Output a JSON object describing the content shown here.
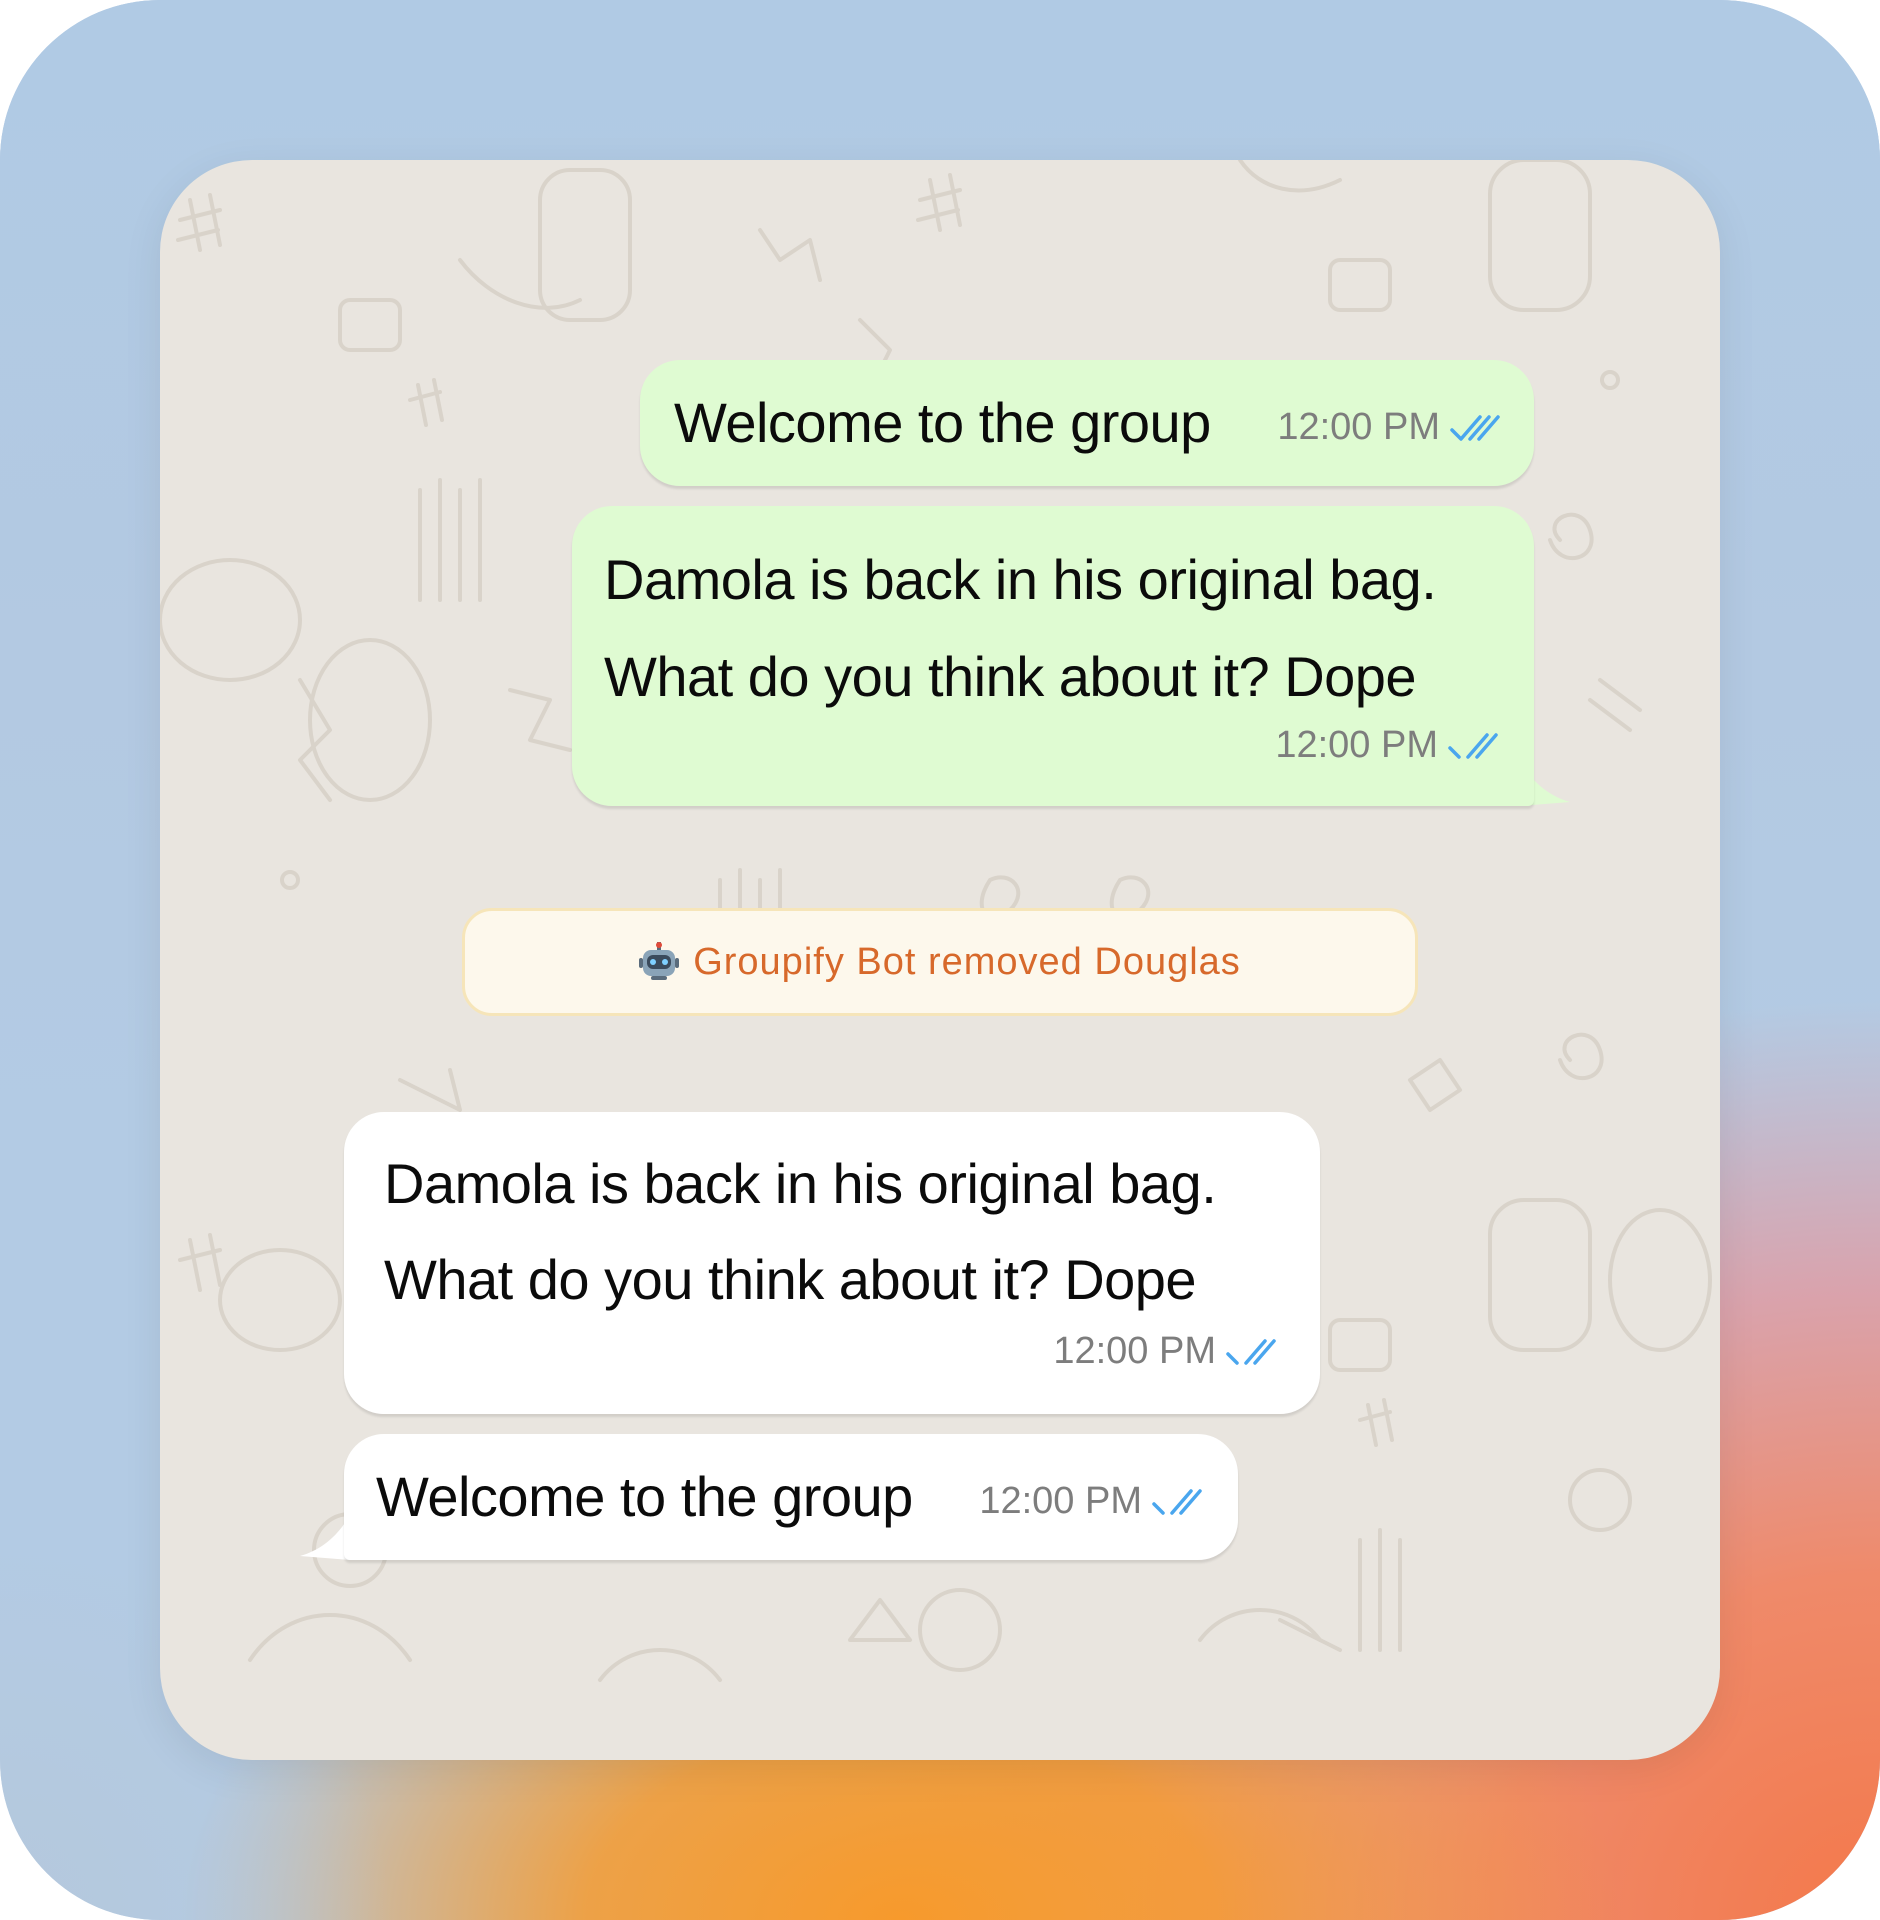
{
  "colors": {
    "outgoing_bubble": "#dffbd2",
    "incoming_bubble": "#ffffff",
    "chat_background": "#e9e5df",
    "read_ticks": "#4aa6ee",
    "system_text": "#d7692b",
    "system_background": "#fdf8ec"
  },
  "messages": [
    {
      "direction": "outgoing",
      "lines": [
        "Welcome to the group"
      ],
      "time": "12:00 PM",
      "status_icon": "double-check-icon"
    },
    {
      "direction": "outgoing",
      "lines": [
        "Damola is back in his original bag.",
        "What do you think about it? Dope"
      ],
      "time": "12:00 PM",
      "status_icon": "double-check-icon"
    },
    {
      "direction": "incoming",
      "lines": [
        "Damola is back in his original bag.",
        "What do you think about it? Dope"
      ],
      "time": "12:00 PM",
      "status_icon": "double-check-icon"
    },
    {
      "direction": "incoming",
      "lines": [
        "Welcome to the group"
      ],
      "time": "12:00 PM",
      "status_icon": "double-check-icon"
    }
  ],
  "system_notice": {
    "icon": "robot-icon",
    "text": "Groupify Bot removed Douglas"
  }
}
